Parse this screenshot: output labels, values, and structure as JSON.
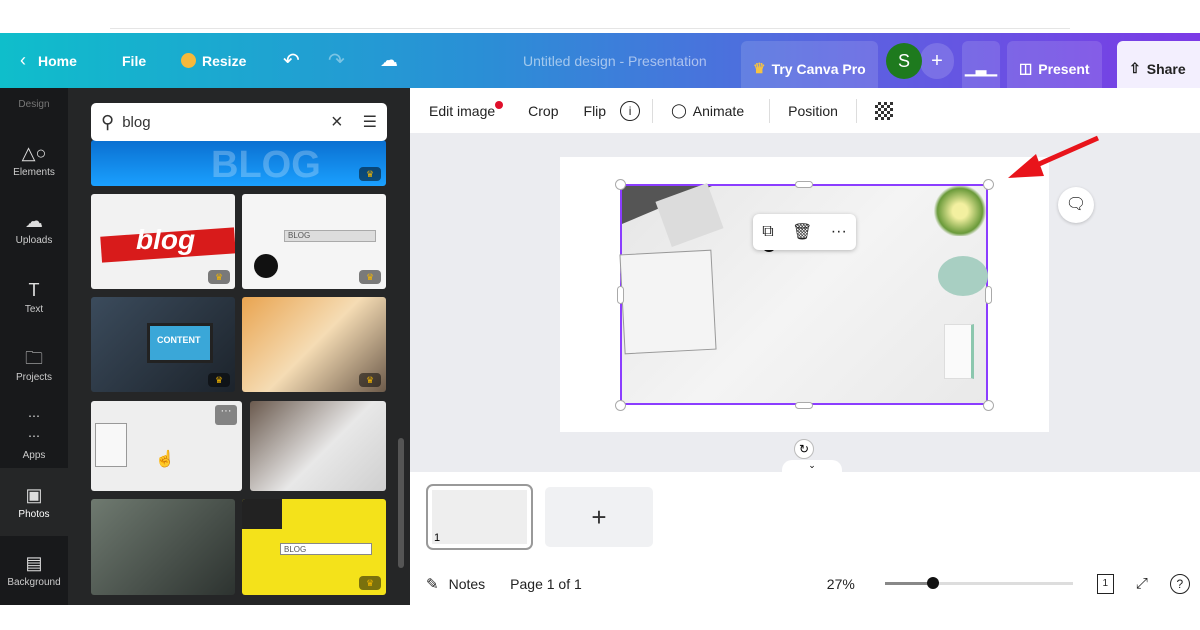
{
  "topbar": {
    "home": "Home",
    "file": "File",
    "resize": "Resize",
    "title": "Untitled design - Presentation",
    "try_pro": "Try Canva Pro",
    "avatar": "S",
    "present": "Present",
    "share": "Share"
  },
  "sidebar": {
    "items": [
      {
        "label": "Design",
        "icon": "design-icon"
      },
      {
        "label": "Elements",
        "icon": "elements-icon"
      },
      {
        "label": "Uploads",
        "icon": "upload-icon"
      },
      {
        "label": "Text",
        "icon": "text-icon"
      },
      {
        "label": "Projects",
        "icon": "folder-icon"
      },
      {
        "label": "Apps",
        "icon": "apps-icon"
      },
      {
        "label": "Photos",
        "icon": "photos-icon"
      },
      {
        "label": "Background",
        "icon": "background-icon"
      }
    ],
    "active": "Photos"
  },
  "panel": {
    "search_value": "blog",
    "photos": [
      {
        "text": "BLOG"
      },
      {
        "text": "blog"
      },
      {
        "text": "BLOG"
      },
      {
        "text": "CONTENT"
      },
      {
        "text": ""
      },
      {
        "text": ""
      },
      {
        "text": ""
      },
      {
        "text": ""
      },
      {
        "text": "BLOG"
      }
    ]
  },
  "context_toolbar": {
    "edit_image": "Edit image",
    "crop": "Crop",
    "flip": "Flip",
    "animate": "Animate",
    "position": "Position"
  },
  "footer": {
    "notes": "Notes",
    "page": "Page 1 of 1",
    "zoom": "27%",
    "zoom_value": 27,
    "page_count": "1"
  },
  "thumbnails": {
    "page_number": "1"
  },
  "colors": {
    "selection": "#8b3dff",
    "arrow": "#e8141b",
    "avatar": "#1e7a1e"
  }
}
